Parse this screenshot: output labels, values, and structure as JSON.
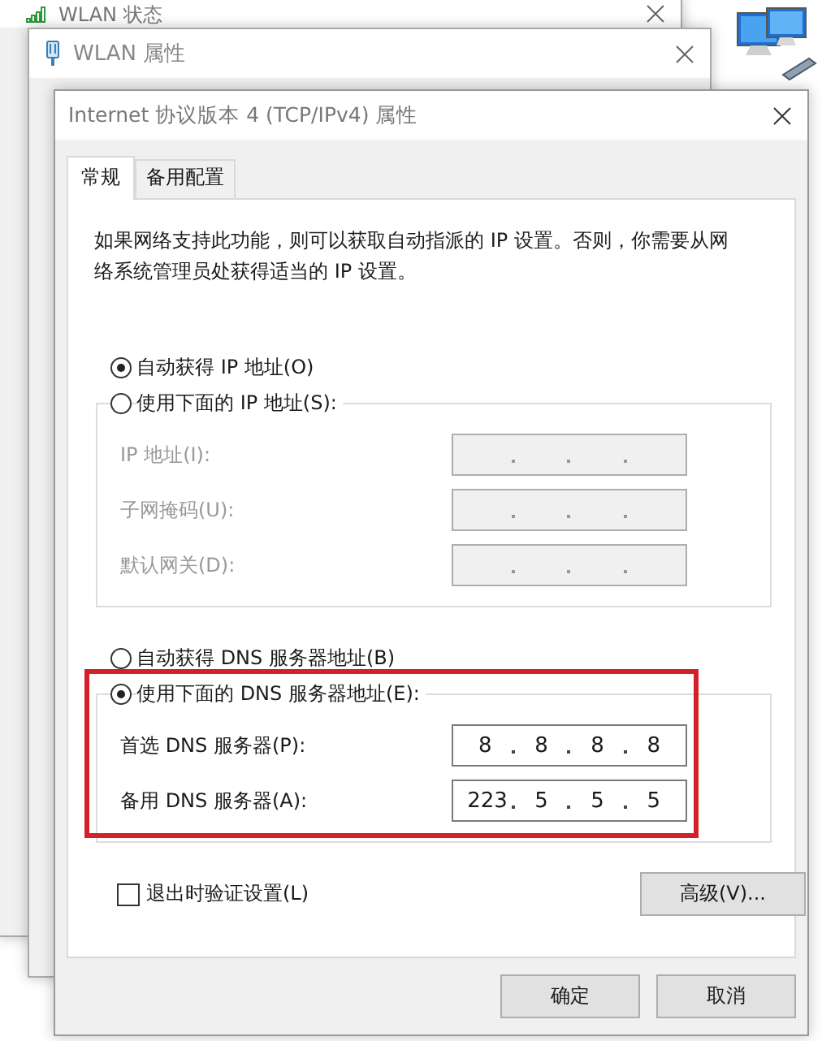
{
  "background_windows": [
    {
      "title": "WLAN 状态"
    },
    {
      "title": "WLAN 属性"
    }
  ],
  "dialog": {
    "title": "Internet 协议版本 4 (TCP/IPv4) 属性",
    "tabs": [
      {
        "label": "常规",
        "selected": true
      },
      {
        "label": "备用配置",
        "selected": false
      }
    ],
    "description": "如果网络支持此功能，则可以获取自动指派的 IP 设置。否则，你需要从网络系统管理员处获得适当的 IP 设置。",
    "ip_options": [
      {
        "label": "自动获得 IP 地址(O)",
        "selected": true
      },
      {
        "label": "使用下面的 IP 地址(S):",
        "selected": false
      }
    ],
    "ip_fields": [
      {
        "label": "IP 地址(I):",
        "disabled": true
      },
      {
        "label": "子网掩码(U):",
        "disabled": true
      },
      {
        "label": "默认网关(D):",
        "disabled": true
      }
    ],
    "dns_options": [
      {
        "label": "自动获得 DNS 服务器地址(B)",
        "selected": false
      },
      {
        "label": "使用下面的 DNS 服务器地址(E):",
        "selected": true
      }
    ],
    "dns_fields": [
      {
        "label": "首选 DNS 服务器(P):",
        "disabled": false,
        "octets": [
          "8",
          "8",
          "8",
          "8"
        ]
      },
      {
        "label": "备用 DNS 服务器(A):",
        "disabled": false,
        "octets": [
          "223",
          "5",
          "5",
          "5"
        ]
      }
    ],
    "validate_checkbox": {
      "label": "退出时验证设置(L)",
      "checked": false
    },
    "advanced_button": "高级(V)...",
    "buttons": [
      "确定",
      "取消"
    ]
  }
}
